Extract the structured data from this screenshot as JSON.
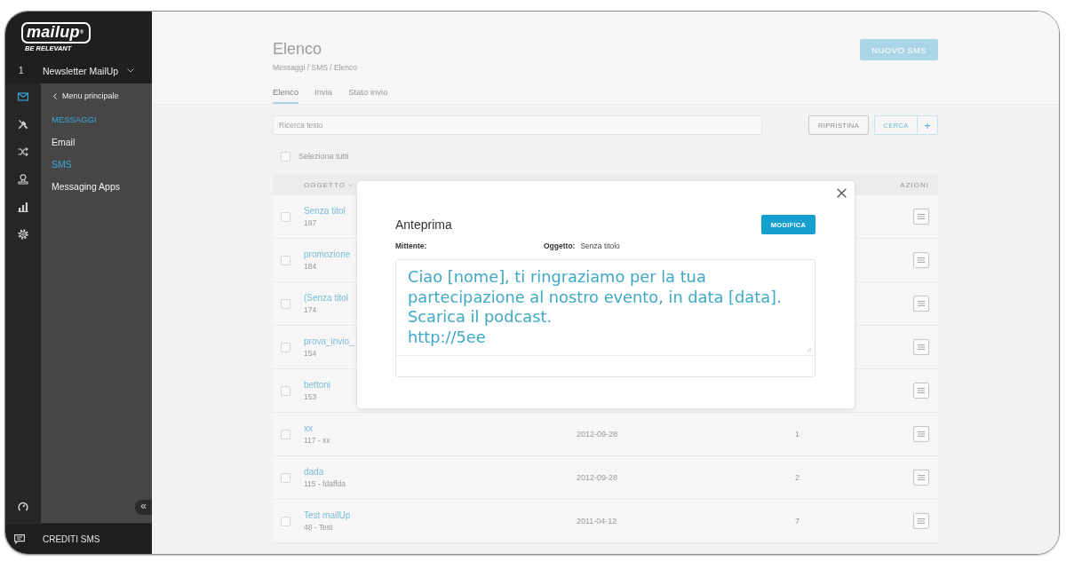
{
  "sidebar": {
    "logo": {
      "wordmark": "mailup$^{®}$",
      "tagline": "BE RELEVANT"
    },
    "account": {
      "number": "1",
      "name": "Newsletter MailUp"
    },
    "nav_icons": [
      {
        "kind": "mail",
        "selected": true
      },
      {
        "kind": "tools",
        "selected": false
      },
      {
        "kind": "shuffle",
        "selected": false
      },
      {
        "kind": "stamp",
        "selected": false
      },
      {
        "kind": "chart",
        "selected": false
      },
      {
        "kind": "settings",
        "selected": false
      }
    ],
    "submenu": {
      "back_link": "Menu principale",
      "section": "MESSAGGI",
      "items": [
        {
          "label": "Email",
          "selected": false
        },
        {
          "label": "SMS",
          "selected": true
        },
        {
          "label": "Messaging Apps",
          "selected": false
        }
      ]
    },
    "collapse_button": "«",
    "footer_link": "CREDITI SMS"
  },
  "page": {
    "title": "Elenco",
    "breadcrumb": "Messaggi / SMS / Elenco",
    "new_button": "NUOVO SMS",
    "tabs": [
      {
        "label": "Elenco",
        "selected": true
      },
      {
        "label": "Invia",
        "selected": false
      },
      {
        "label": "Stato invio",
        "selected": false
      }
    ],
    "search": {
      "placeholder": "Ricerca testo"
    },
    "reset_button": "RIPRISTINA",
    "search_button": "CERCA",
    "add_button": "+",
    "select_all": {
      "label": "Seleziona tutti",
      "checked": false
    }
  },
  "table": {
    "columns": [
      "OGGETTO",
      "AZIONI"
    ],
    "rows": [
      {
        "title": "Senza titol",
        "meta": "197",
        "checked": false
      },
      {
        "title": "promozione",
        "meta": "184",
        "checked": false
      },
      {
        "title": "(Senza titol",
        "meta": "174",
        "checked": false
      },
      {
        "title": "prova_invio_",
        "meta": "154",
        "checked": false
      },
      {
        "title": "bettoni",
        "meta": "153",
        "checked": false
      },
      {
        "title": "xx",
        "meta": "117 - xx",
        "date": "2012-09-28",
        "count": "1",
        "checked": false
      },
      {
        "title": "dada",
        "meta": "115 - fdaffda",
        "date": "2012-09-28",
        "count": "2",
        "checked": false
      },
      {
        "title": "Test mailUp",
        "meta": "48 - Test",
        "date": "2011-04-12",
        "count": "7",
        "checked": false
      }
    ]
  },
  "dialog": {
    "title": "Anteprima",
    "edit_button": "MODIFICA",
    "sender_label": "Mittente:",
    "subject_label": "Oggetto:",
    "subject": "Senza titolo",
    "message": "Ciao [nome], ti ringraziamo per la tua partecipazione al nostro evento, in data [data].\nScarica il podcast.\nhttp://5ee"
  }
}
